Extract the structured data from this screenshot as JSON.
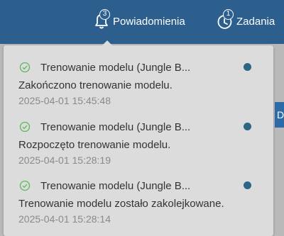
{
  "header": {
    "notifications": {
      "label": "Powiadomienia",
      "badge": "3",
      "icon": "bell-icon"
    },
    "tasks": {
      "label": "Zadania",
      "badge": "1",
      "icon": "clock-icon"
    },
    "side_button_label": "Do"
  },
  "notifications": {
    "items": [
      {
        "title": "Trenowanie modelu (Jungle B...",
        "message": "Zakończono trenowanie modelu.",
        "time": "2025-04-01 15:45:48",
        "status_icon": "check-circle-icon",
        "unread": true
      },
      {
        "title": "Trenowanie modelu (Jungle B...",
        "message": "Rozpoczęto trenowanie modelu.",
        "time": "2025-04-01 15:28:19",
        "status_icon": "check-circle-icon",
        "unread": true
      },
      {
        "title": "Trenowanie modelu (Jungle B...",
        "message": "Trenowanie modelu zostało zakolejkowane.",
        "time": "2025-04-01 15:28:14",
        "status_icon": "check-circle-icon",
        "unread": true
      }
    ]
  },
  "colors": {
    "header_bg": "#2d5f8e",
    "dropdown_bg": "#dcdcdc",
    "check": "#5cb85c",
    "unread_dot": "#2d6685"
  }
}
